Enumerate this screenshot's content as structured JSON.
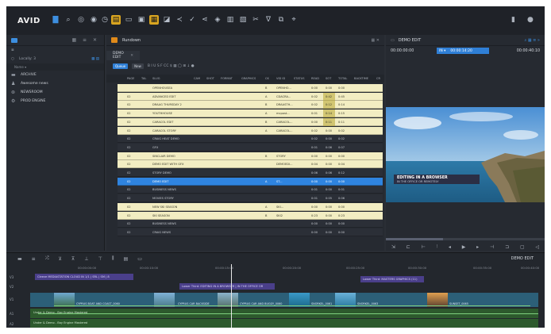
{
  "app": {
    "logo_text": "AVID",
    "toolbar_icons": [
      "folder-icon",
      "search-icon",
      "globe-icon",
      "compass-icon",
      "clock-icon",
      "rundown-icon",
      "database-icon",
      "story-icon",
      "monitor-icon",
      "share-icon",
      "check-icon",
      "link-icon",
      "mixer-icon",
      "grid-icon",
      "graph-icon",
      "filter-icon",
      "network-icon",
      "more-icon"
    ],
    "accent_color": "#d9a520",
    "brand_blue": "#2f7fd6"
  },
  "left_panel": {
    "location_label": "Locally: 3",
    "column_header": "Name ▾",
    "items": [
      {
        "label": "ARCHIVE",
        "icon": "archive-icon"
      },
      {
        "label": "Awesome news",
        "icon": "user-icon"
      },
      {
        "label": "NEWSROOM",
        "icon": "newsroom-icon"
      },
      {
        "label": "PROD ENGINE",
        "icon": "engine-icon"
      }
    ]
  },
  "rundown": {
    "title": "Rundown",
    "tab_label": "DEMO EDIT",
    "format_button": "Queue",
    "new_button": "New",
    "toolbar_glyphs": "B  I  U  S  F  CC  $  ▦  ◯  ⊞  ↓  ●",
    "columns": [
      "PAGE",
      "TAL",
      "SLUG",
      "CAM",
      "SHOT",
      "FORMAT",
      "GRAPHICS",
      "CK",
      "VID ID",
      "STATUS",
      "READ",
      "SOT",
      "TOTAL",
      "BACKTIME",
      "CR"
    ],
    "rows": [
      {
        "page": "",
        "slug": "OPENHOUSEA",
        "ck": "B",
        "vid": "OPENHO...",
        "read": "0:00",
        "sot": "0:00",
        "total": "0:00",
        "style": "yellow"
      },
      {
        "page": "02",
        "slug": "ADVANCED EDIT",
        "ck": "A",
        "vid": "CDACRA...",
        "read": "0:02",
        "sot": "0:42",
        "total": "0:45",
        "style": "yellow"
      },
      {
        "page": "02",
        "slug": "DRAAG THURSDAY 2",
        "ck": "B",
        "vid": "DRAASTH...",
        "read": "0:02",
        "sot": "0:12",
        "total": "0:14",
        "style": "yellow"
      },
      {
        "page": "02",
        "slug": "YOUTHHOUSE",
        "ck": "A",
        "vid": "mcpost...",
        "read": "0:01",
        "sot": "0:14",
        "total": "0:15",
        "style": "yellow"
      },
      {
        "page": "02",
        "slug": "CARACOL EDIT",
        "ck": "B",
        "vid": "CARACOL...",
        "read": "0:00",
        "sot": "0:11",
        "total": "0:11",
        "style": "yellow"
      },
      {
        "page": "02",
        "slug": "CARACOL STORY",
        "ck": "A",
        "vid": "CARACOL...",
        "read": "0:02",
        "sot": "0:00",
        "total": "0:02",
        "style": "yellow"
      },
      {
        "page": "02",
        "slug": "CRAIG HEAT DEMO",
        "ck": "",
        "vid": "",
        "read": "0:02",
        "sot": "0:00",
        "total": "0:02",
        "style": "dark"
      },
      {
        "page": "02",
        "slug": "GFX",
        "ck": "",
        "vid": "",
        "read": "0:01",
        "sot": "0:06",
        "total": "0:07",
        "style": "dark"
      },
      {
        "page": "02",
        "slug": "SINCLAIR DEMO",
        "ck": "B",
        "vid": "STORY",
        "read": "0:00",
        "sot": "0:00",
        "total": "0:00",
        "style": "yellow"
      },
      {
        "page": "02",
        "slug": "DEMO EDIT WITH GFX",
        "ck": "",
        "vid": "DEMOEDI...",
        "read": "0:04",
        "sot": "0:00",
        "total": "0:04",
        "style": "yellow"
      },
      {
        "page": "02",
        "slug": "STORY DEMO",
        "ck": "",
        "vid": "",
        "read": "0:06",
        "sot": "0:06",
        "total": "0:12",
        "style": "dark"
      },
      {
        "page": "02",
        "slug": "DEMO EDIT",
        "ck": "A",
        "vid": "ST...",
        "read": "0:00",
        "sot": "0:00",
        "total": "0:00",
        "style": "blue"
      },
      {
        "page": "02",
        "slug": "BUSINESS NEWS",
        "ck": "",
        "vid": "",
        "read": "0:01",
        "sot": "0:00",
        "total": "0:01",
        "style": "dark"
      },
      {
        "page": "02",
        "slug": "MOVIES STORY",
        "ck": "",
        "vid": "",
        "read": "0:01",
        "sot": "0:05",
        "total": "0:06",
        "style": "dark"
      },
      {
        "page": "02",
        "slug": "NEW SKI SEASON",
        "ck": "A",
        "vid": "SKI...",
        "read": "0:00",
        "sot": "0:00",
        "total": "0:00",
        "style": "yellow"
      },
      {
        "page": "02",
        "slug": "SKI SEASON",
        "ck": "B",
        "vid": "SKI2",
        "read": "0:23",
        "sot": "0:00",
        "total": "0:23",
        "style": "yellow"
      },
      {
        "page": "02",
        "slug": "BUSINESS NEWS",
        "ck": "",
        "vid": "",
        "read": "0:00",
        "sot": "0:00",
        "total": "0:00",
        "style": "dark"
      },
      {
        "page": "02",
        "slug": "CRAIG NEWS",
        "ck": "",
        "vid": "",
        "read": "0:00",
        "sot": "0:00",
        "total": "0:00",
        "style": "dark"
      }
    ]
  },
  "preview": {
    "title": "DEMO EDIT",
    "tc_start": "00:00:00:00",
    "tc_current": "00:00:14:20",
    "tc_mode": "IN ▾",
    "tc_end": "00:00:40:10",
    "caption_line1": "EDITING IN A BROWSER",
    "caption_line2": "IN THE OFFICE OR REMOTELY"
  },
  "timeline": {
    "sequence_label": "DEMO EDIT",
    "ruler_ticks": [
      "00:00:00:00",
      "00:00:10:00",
      "00:00:15:00",
      "00:00:20:00",
      "00:00:25:00",
      "00:00:30:00",
      "00:00:35:00",
      "00:00:40:00"
    ],
    "track_labels": [
      "V3",
      "V2",
      "V1",
      "A1",
      "A2"
    ],
    "clips": {
      "v3": "Cleeve MEDIASTATION CLOUD IN 1/1 | SRL | SM | 8",
      "v2a": "Lower Third: EDITING IN A BROWSER | IN THE OFFICE OR",
      "v2b": "Lower Third: MASTERS GRAPHICS (11)",
      "v1": [
        "CYPRUS BOAT AND COAST_0060",
        "CYPRUS CAR BACKSIDE",
        "CYPRUS CAR AND BUGGY_0060",
        "SNORKEL_0061",
        "SNORKEL_0063",
        "SUNSET_0065"
      ],
      "a1": "Under & Demo - Bay Engine Mastered",
      "a2": "Under & Demo - Bay Engine Mastered"
    }
  }
}
